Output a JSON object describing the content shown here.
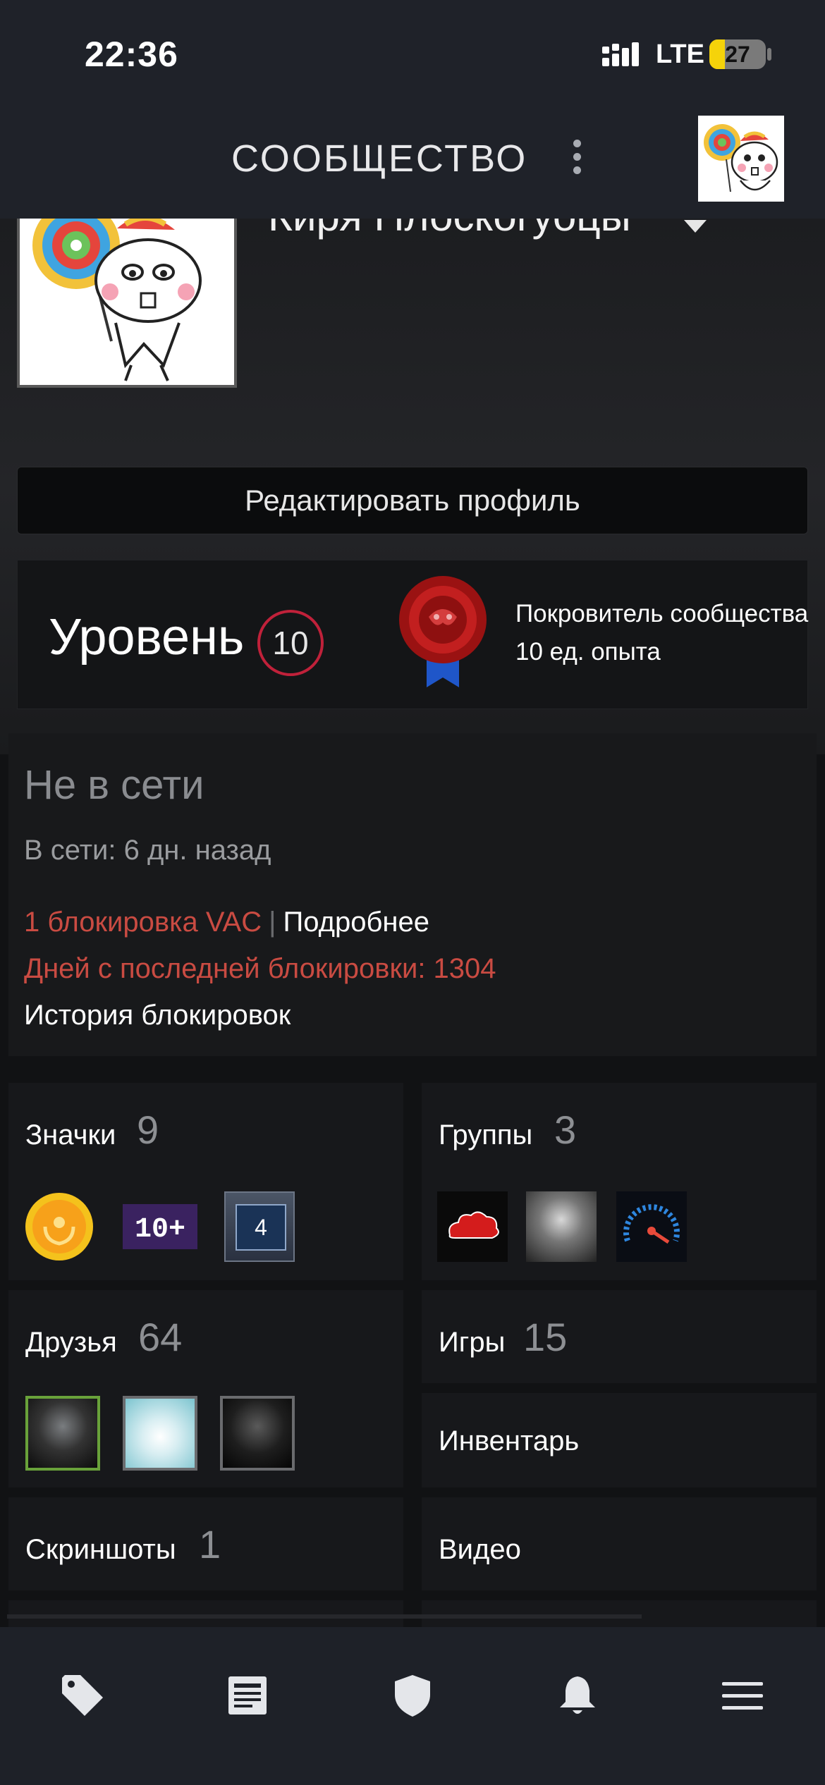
{
  "status_bar": {
    "time": "22:36",
    "network": "LTE",
    "battery": "27",
    "battery_level": 0.27
  },
  "header": {
    "title": "СООБЩЕСТВО",
    "menu_icon": "kebab-icon",
    "avatar_icon": "user-avatar"
  },
  "profile": {
    "username": "Киря Плоскогуоцы",
    "edit_button": "Редактировать профиль",
    "level_label": "Уровень",
    "level": "10",
    "badge_title": "Покровитель сообщества",
    "badge_xp": "10 ед. опыта"
  },
  "status": {
    "state": "Не в сети",
    "last_online": "В сети: 6 дн. назад",
    "vac_bans": "1 блокировка VAC",
    "vac_details": "Подробнее",
    "days_since_ban": "Дней с последней блокировки: 1304",
    "ban_history": "История блокировок"
  },
  "tiles": {
    "badges": {
      "label": "Значки",
      "count": "9",
      "third_badge": "4"
    },
    "groups": {
      "label": "Группы",
      "count": "3"
    },
    "friends": {
      "label": "Друзья",
      "count": "64"
    },
    "games": {
      "label": "Игры",
      "count": "15"
    },
    "inventory": {
      "label": "Инвентарь"
    },
    "screenshots": {
      "label": "Скриншоты",
      "count": "1"
    },
    "videos": {
      "label": "Видео"
    }
  },
  "bottom_nav": [
    "tag-icon",
    "news-icon",
    "shield-icon",
    "bell-icon",
    "menu-icon"
  ],
  "colors": {
    "accent_red": "#c94b42",
    "level_ring": "#c0213a",
    "header_bg": "#1f2229"
  }
}
